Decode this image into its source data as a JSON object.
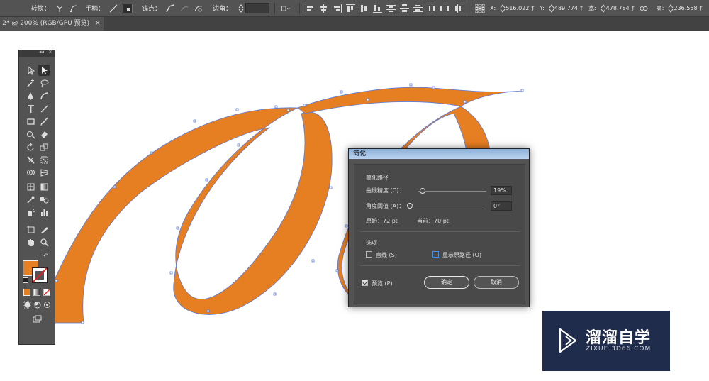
{
  "control_bar": {
    "convert_label": "转换：",
    "handles_label": "手柄：",
    "anchors_label": "锚点：",
    "corners_label": "边角：",
    "x_label": "X:",
    "x_value": "516.022",
    "y_label": "Y:",
    "y_value": "489.774",
    "w_label": "宽:",
    "w_value": "478.784",
    "h_label": "高:",
    "h_value": "236.558",
    "unit_suffix": "‡"
  },
  "document_tab": {
    "title": "-2* @ 200% (RGB/GPU 预览)",
    "close": "×"
  },
  "colors": {
    "fill": "#e67e22",
    "path_outline": "#5b7bd6",
    "dialog_title": "#9bbde2"
  },
  "dialog": {
    "title": "简化",
    "section_path": "简化路径",
    "curve_precision_label": "曲线精度 (C)：",
    "curve_precision_value": "19%",
    "curve_precision": 0.19,
    "angle_threshold_label": "角度阈值 (A)：",
    "angle_threshold_value": "0°",
    "angle_threshold": 0,
    "original_label": "原始：72 pt",
    "current_label": "当前：70 pt",
    "section_options": "选项",
    "straight_lines_label": "直线 (S)",
    "straight_lines_checked": false,
    "show_original_label": "显示原路径 (O)",
    "show_original_checked": false,
    "preview_label": "预览 (P)",
    "preview_checked": true,
    "ok_label": "确定",
    "cancel_label": "取消"
  },
  "toolbox": {
    "collapse": "◂◂",
    "close": "×",
    "tools": [
      "selection-tool",
      "direct-selection-tool",
      "magic-wand-tool",
      "lasso-tool",
      "pen-tool",
      "curvature-tool",
      "type-tool",
      "line-tool",
      "rectangle-tool",
      "paintbrush-tool",
      "shaper-tool",
      "eraser-tool",
      "rotate-tool",
      "scale-tool",
      "width-tool",
      "free-transform-tool",
      "shape-builder-tool",
      "perspective-grid-tool",
      "mesh-tool",
      "gradient-tool",
      "eyedropper-tool",
      "blend-tool",
      "symbol-sprayer-tool",
      "column-graph-tool",
      "artboard-tool",
      "slice-tool",
      "hand-tool",
      "zoom-tool"
    ]
  },
  "watermark": {
    "name": "溜溜自学",
    "url": "ZIXUE.3D66.COM"
  }
}
